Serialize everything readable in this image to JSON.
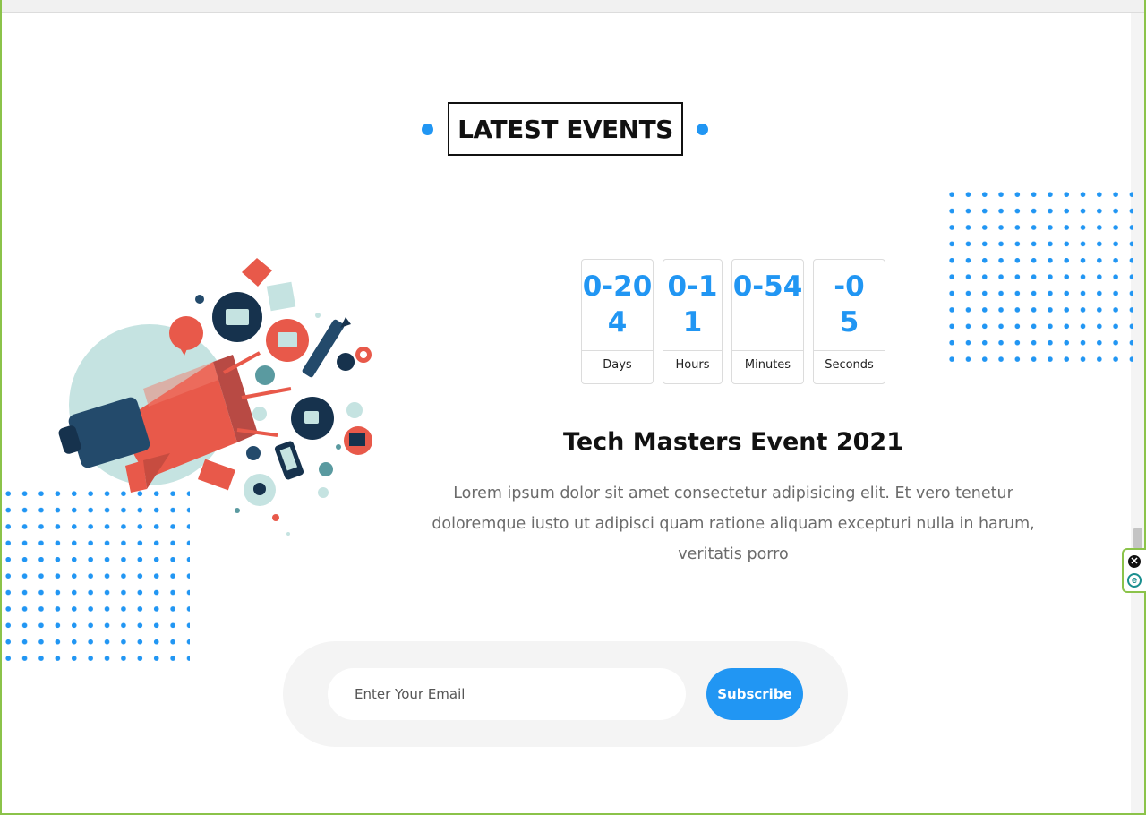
{
  "section": {
    "title": "LATEST EVENTS"
  },
  "countdown": [
    {
      "value": "0-204",
      "label": "Days"
    },
    {
      "value": "0-11",
      "label": "Hours"
    },
    {
      "value": "0-54",
      "label": "Minutes"
    },
    {
      "value": "-05",
      "label": "Seconds"
    }
  ],
  "event": {
    "title": "Tech Masters Event 2021",
    "description": "Lorem ipsum dolor sit amet consectetur adipisicing elit. Et vero tenetur doloremque iusto ut adipisci quam ratione aliquam excepturi nulla in harum, veritatis porro"
  },
  "subscribe": {
    "placeholder": "Enter Your Email",
    "button_label": "Subscribe"
  },
  "side_widget": {
    "close_glyph": "✕",
    "e_glyph": "e"
  },
  "colors": {
    "accent": "#2196f3",
    "frame": "#8bc34a",
    "heading": "#111111",
    "body_text": "#6b6b6b"
  }
}
